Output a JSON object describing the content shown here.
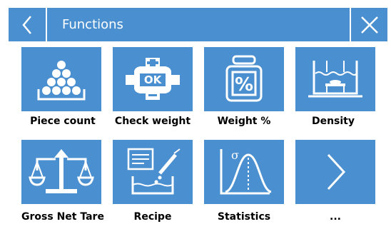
{
  "header": {
    "title": "Functions",
    "back_icon": "chevron-left-icon",
    "close_icon": "close-icon"
  },
  "tiles": [
    {
      "label": "Piece count",
      "icon": "piece-count-icon"
    },
    {
      "label": "Check weight",
      "icon": "check-weight-icon"
    },
    {
      "label": "Weight %",
      "icon": "weight-percent-icon"
    },
    {
      "label": "Density",
      "icon": "density-icon"
    },
    {
      "label": "Gross Net Tare",
      "icon": "gross-net-tare-icon"
    },
    {
      "label": "Recipe",
      "icon": "recipe-icon"
    },
    {
      "label": "Statistics",
      "icon": "statistics-icon"
    },
    {
      "label": "...",
      "icon": "chevron-right-icon"
    }
  ],
  "colors": {
    "accent": "#4a8fd0",
    "icon": "#ffffff",
    "label": "#000000",
    "background": "#ffffff"
  },
  "icon_glyphs": {
    "ok_text": "OK",
    "plus": "+",
    "minus": "−",
    "percent": "%",
    "sigma": "σ"
  }
}
